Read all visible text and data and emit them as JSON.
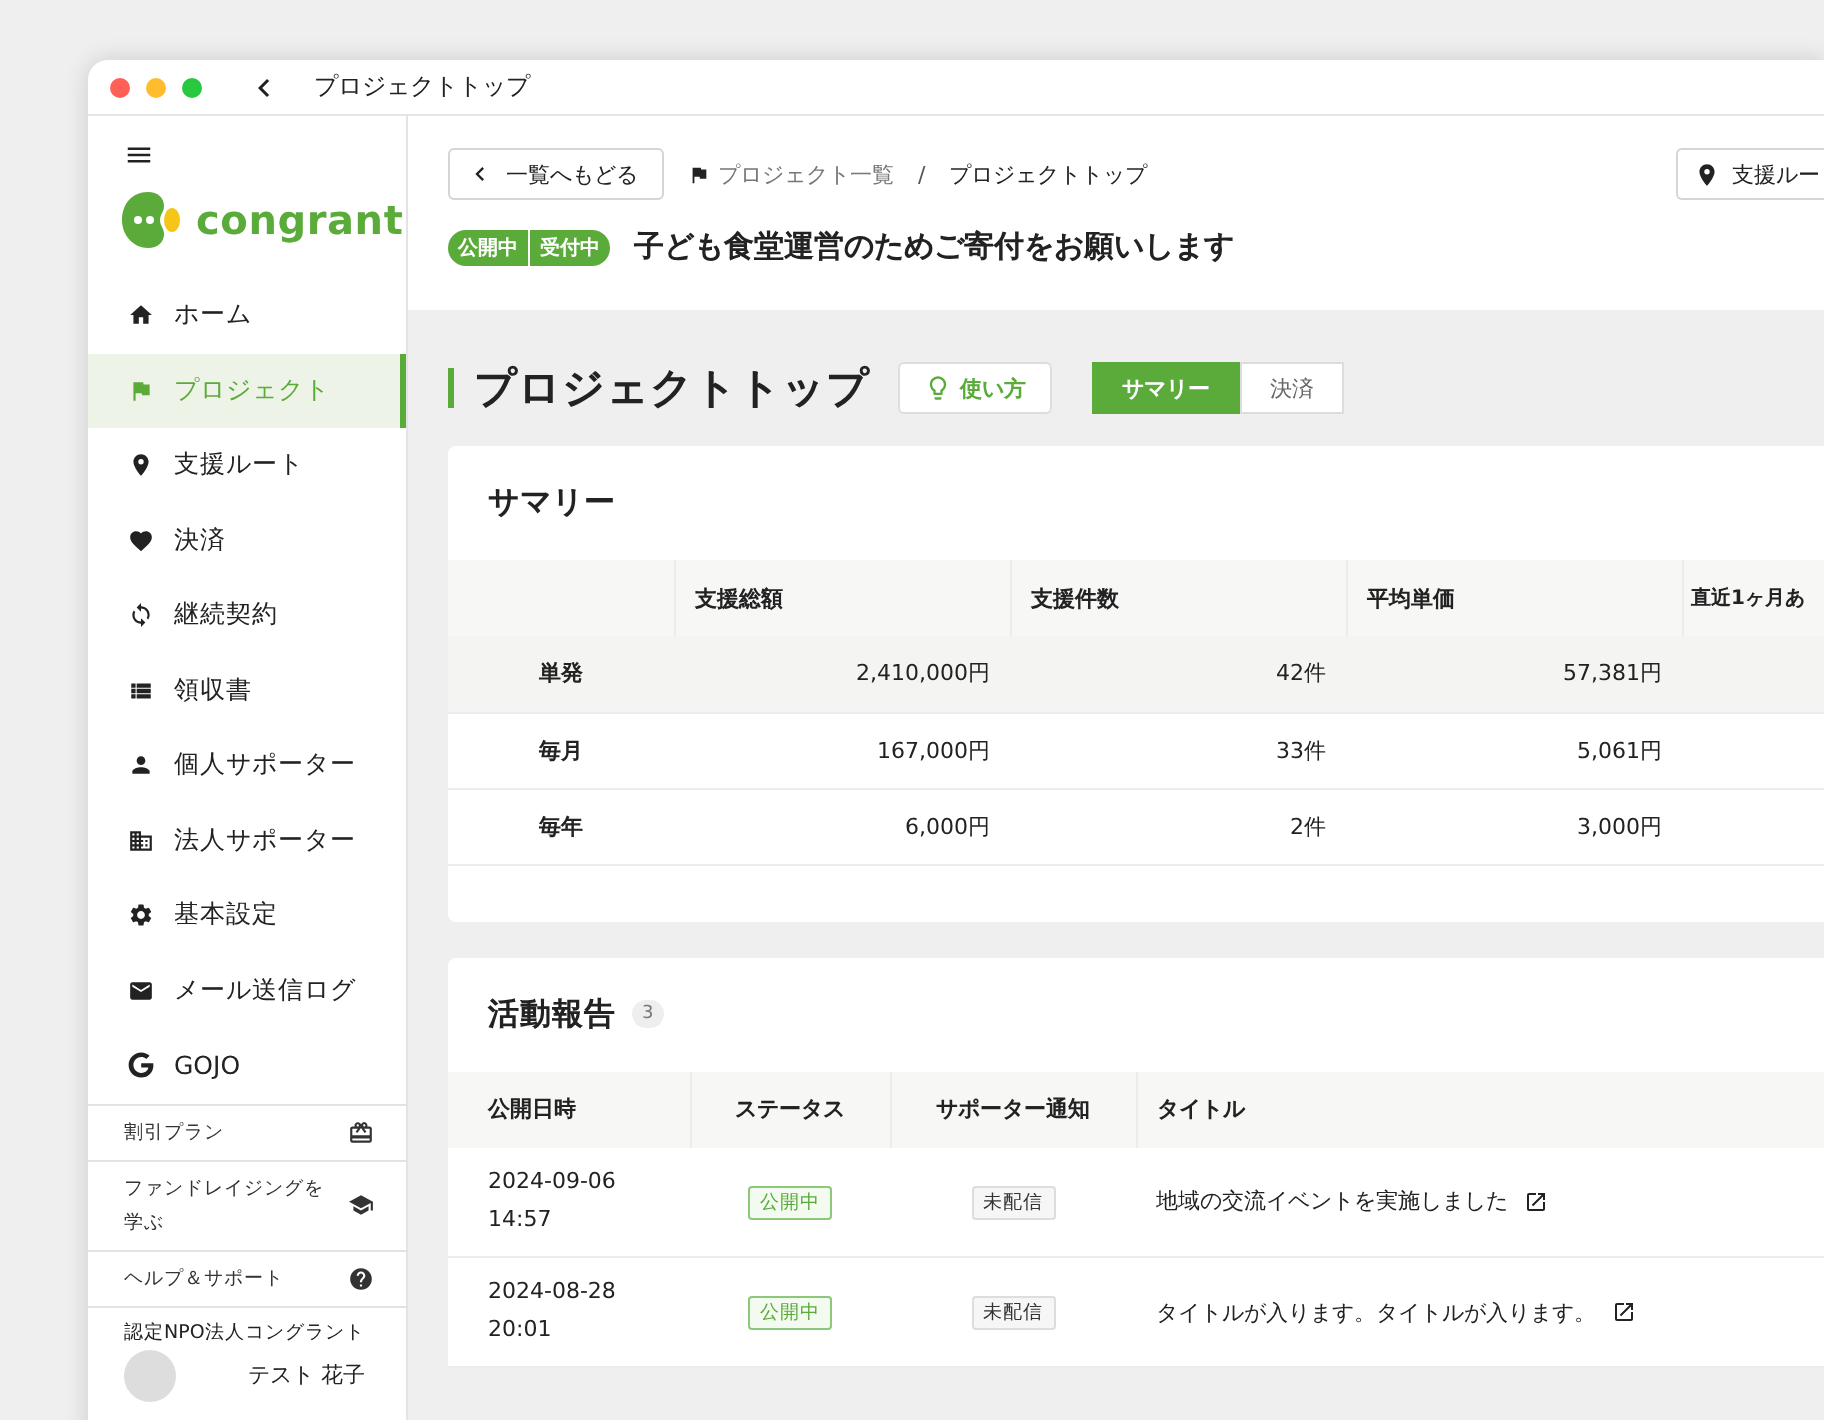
{
  "window": {
    "title": "プロジェクトトップ"
  },
  "sidebar": {
    "logo_text": "congrant",
    "items": [
      {
        "label": "ホーム",
        "selected": false
      },
      {
        "label": "プロジェクト",
        "selected": true
      },
      {
        "label": "支援ルート",
        "selected": false
      },
      {
        "label": "決済",
        "selected": false
      },
      {
        "label": "継続契約",
        "selected": false
      },
      {
        "label": "領収書",
        "selected": false
      },
      {
        "label": "個人サポーター",
        "selected": false
      },
      {
        "label": "法人サポーター",
        "selected": false
      },
      {
        "label": "基本設定",
        "selected": false
      },
      {
        "label": "メール送信ログ",
        "selected": false
      },
      {
        "label": "GOJO",
        "selected": false
      }
    ],
    "links": [
      "割引プラン",
      "ファンドレイジングを学ぶ",
      "ヘルプ＆サポート"
    ],
    "organization": "認定NPO法人コングラント",
    "user_name": "テスト 花子"
  },
  "header": {
    "back_button": "一覧へもどる",
    "breadcrumb": [
      "プロジェクト一覧",
      "プロジェクトトップ"
    ],
    "breadcrumb_separator": "/",
    "route_button": "支援ルー",
    "badges": [
      "公開中",
      "受付中"
    ],
    "project_title": "子ども食堂運営のためご寄付をお願いします"
  },
  "page": {
    "heading": "プロジェクトトップ",
    "help_button": "使い方",
    "tabs": [
      {
        "label": "サマリー",
        "selected": true
      },
      {
        "label": "決済",
        "selected": false
      }
    ]
  },
  "summary": {
    "title": "サマリー",
    "columns": [
      "支援総額",
      "支援件数",
      "平均単価",
      "直近1ヶ月あ"
    ],
    "rows": [
      {
        "label": "単発",
        "highlighted": true,
        "cells": [
          "2,410,000円",
          "42件",
          "57,381円"
        ]
      },
      {
        "label": "毎月",
        "highlighted": false,
        "cells": [
          "167,000円",
          "33件",
          "5,061円"
        ]
      },
      {
        "label": "毎年",
        "highlighted": false,
        "cells": [
          "6,000円",
          "2件",
          "3,000円"
        ]
      }
    ]
  },
  "reports": {
    "title": "活動報告",
    "count": "3",
    "columns": [
      "公開日時",
      "ステータス",
      "サポーター通知",
      "タイトル"
    ],
    "rows": [
      {
        "date": "2024-09-06",
        "time": "14:57",
        "status": "公開中",
        "notice": "未配信",
        "title": "地域の交流イベントを実施しました"
      },
      {
        "date": "2024-08-28",
        "time": "20:01",
        "status": "公開中",
        "notice": "未配信",
        "title": "タイトルが入ります。タイトルが入ります。"
      }
    ]
  }
}
